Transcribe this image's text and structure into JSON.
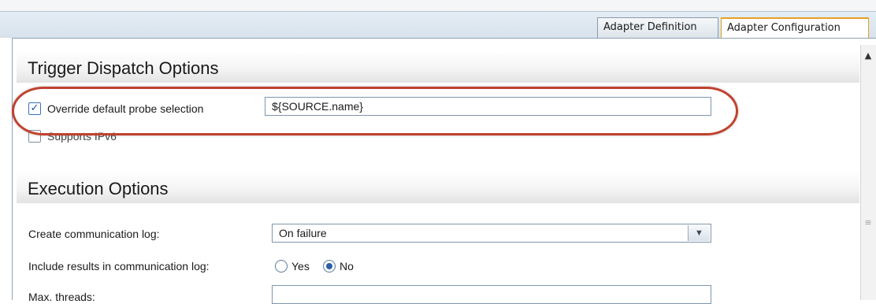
{
  "tabs": [
    {
      "label": "Adapter Definition",
      "active": false
    },
    {
      "label": "Adapter Configuration",
      "active": true
    }
  ],
  "sections": {
    "trigger_dispatch": {
      "title": "Trigger Dispatch Options",
      "override_probe": {
        "label": "Override default probe selection",
        "checked": true,
        "value": "${SOURCE.name}"
      },
      "supports_ipv6": {
        "label": "Supports IPv6",
        "checked": false
      }
    },
    "execution": {
      "title": "Execution Options",
      "communication_log": {
        "label": "Create communication log:",
        "value": "On failure"
      },
      "include_results": {
        "label": "Include results in communication log:",
        "options": [
          "Yes",
          "No"
        ],
        "selected": "No"
      },
      "max_threads": {
        "label": "Max. threads:",
        "value": ""
      }
    }
  },
  "icons": {
    "scroll_up": "scroll-up-arrow-icon",
    "scroll_grip": "scroll-grip-icon",
    "dropdown": "chevron-down-icon",
    "checkmark": "checkmark-icon"
  },
  "colors": {
    "highlight": "#c0422e",
    "active_tab_accent": "#e8a020",
    "tabbar": "#dde6ef"
  }
}
